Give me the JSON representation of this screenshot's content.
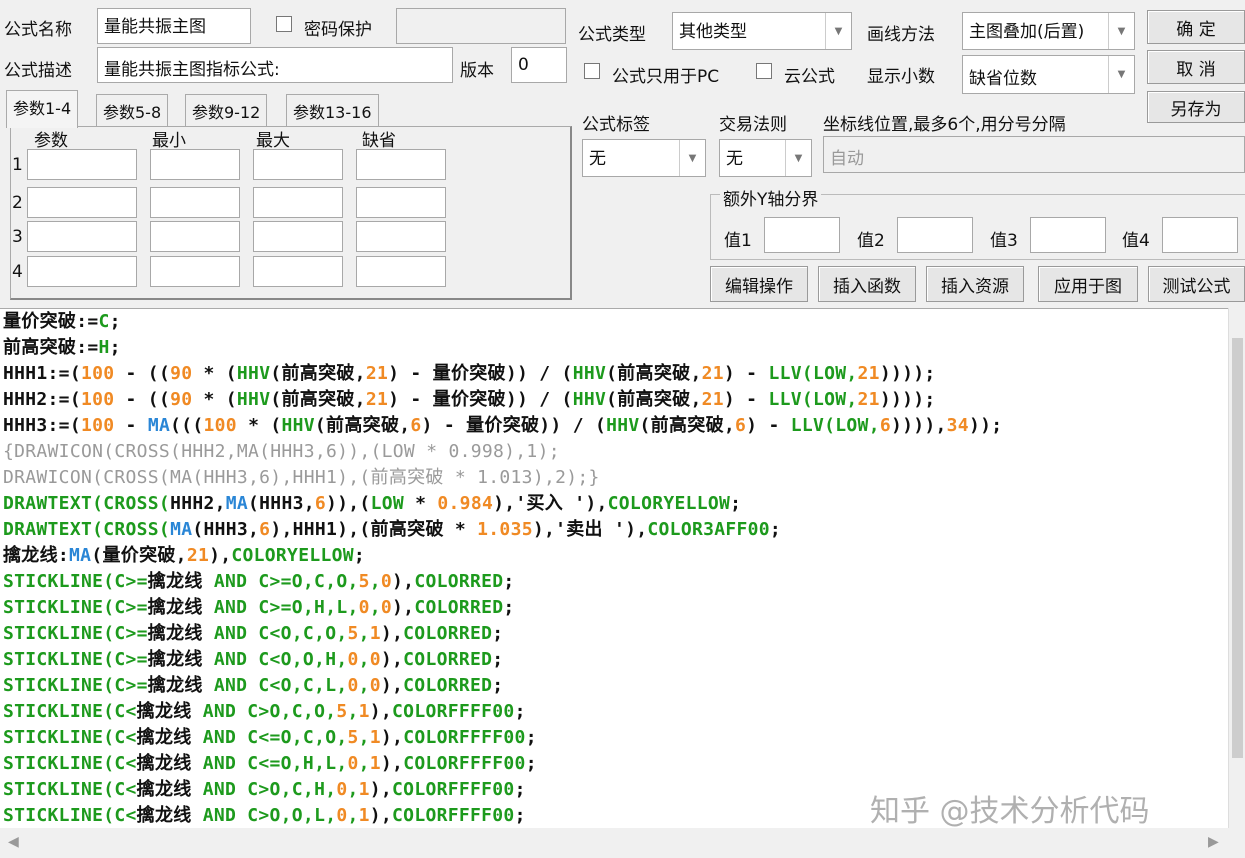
{
  "form": {
    "name_label": "公式名称",
    "name_value": "量能共振主图",
    "password_label": "密码保护",
    "desc_label": "公式描述",
    "desc_value": "量能共振主图指标公式:",
    "version_label": "版本",
    "version_value": "0",
    "type_label": "公式类型",
    "type_value": "其他类型",
    "draw_label": "画线方法",
    "draw_value": "主图叠加(后置)",
    "pc_only_label": "公式只用于PC",
    "cloud_label": "云公式",
    "decimal_label": "显示小数",
    "decimal_value": "缺省位数",
    "tag_label": "公式标签",
    "tag_value": "无",
    "rule_label": "交易法则",
    "rule_value": "无",
    "axis_label": "坐标线位置,最多6个,用分号分隔",
    "axis_placeholder": "自动",
    "yaxis_group": "额外Y轴分界",
    "values": [
      "值1",
      "值2",
      "值3",
      "值4"
    ]
  },
  "buttons": {
    "ok": "确  定",
    "cancel": "取  消",
    "save_as": "另存为",
    "edit": "编辑操作",
    "insert_func": "插入函数",
    "insert_res": "插入资源",
    "apply": "应用于图",
    "test": "测试公式"
  },
  "tabs": [
    "参数1-4",
    "参数5-8",
    "参数9-12",
    "参数13-16"
  ],
  "params": {
    "headers": [
      "参数",
      "最小",
      "最大",
      "缺省"
    ],
    "rows": [
      "1",
      "2",
      "3",
      "4"
    ]
  },
  "code_lines": [
    [
      [
        "k",
        "量价突破:="
      ],
      [
        "g",
        "C"
      ],
      [
        "k",
        ";"
      ]
    ],
    [
      [
        "k",
        "前高突破:="
      ],
      [
        "g",
        "H"
      ],
      [
        "k",
        ";"
      ]
    ],
    [
      [
        "k",
        "HHH1:=("
      ],
      [
        "o",
        "100"
      ],
      [
        "k",
        " - (("
      ],
      [
        "o",
        "90"
      ],
      [
        "k",
        " * ("
      ],
      [
        "g",
        "HHV"
      ],
      [
        "k",
        "(前高突破,"
      ],
      [
        "o",
        "21"
      ],
      [
        "k",
        ") - 量价突破)) / ("
      ],
      [
        "g",
        "HHV"
      ],
      [
        "k",
        "(前高突破,"
      ],
      [
        "o",
        "21"
      ],
      [
        "k",
        ") - "
      ],
      [
        "g",
        "LLV(LOW,"
      ],
      [
        "o",
        "21"
      ],
      [
        "k",
        "))));"
      ]
    ],
    [
      [
        "k",
        "HHH2:=("
      ],
      [
        "o",
        "100"
      ],
      [
        "k",
        " - (("
      ],
      [
        "o",
        "90"
      ],
      [
        "k",
        " * ("
      ],
      [
        "g",
        "HHV"
      ],
      [
        "k",
        "(前高突破,"
      ],
      [
        "o",
        "21"
      ],
      [
        "k",
        ") - 量价突破)) / ("
      ],
      [
        "g",
        "HHV"
      ],
      [
        "k",
        "(前高突破,"
      ],
      [
        "o",
        "21"
      ],
      [
        "k",
        ") - "
      ],
      [
        "g",
        "LLV(LOW,"
      ],
      [
        "o",
        "21"
      ],
      [
        "k",
        "))));"
      ]
    ],
    [
      [
        "k",
        "HHH3:=("
      ],
      [
        "o",
        "100"
      ],
      [
        "k",
        " - "
      ],
      [
        "b",
        "MA"
      ],
      [
        "k",
        "((("
      ],
      [
        "o",
        "100"
      ],
      [
        "k",
        " * ("
      ],
      [
        "g",
        "HHV"
      ],
      [
        "k",
        "(前高突破,"
      ],
      [
        "o",
        "6"
      ],
      [
        "k",
        ") - 量价突破)) / ("
      ],
      [
        "g",
        "HHV"
      ],
      [
        "k",
        "(前高突破,"
      ],
      [
        "o",
        "6"
      ],
      [
        "k",
        ") - "
      ],
      [
        "g",
        "LLV(LOW,"
      ],
      [
        "o",
        "6"
      ],
      [
        "k",
        ")))),"
      ],
      [
        "o",
        "34"
      ],
      [
        "k",
        "));"
      ]
    ],
    [
      [
        "c",
        "{DRAWICON(CROSS(HHH2,MA(HHH3,6)),(LOW * 0.998),1);"
      ]
    ],
    [
      [
        "c",
        "DRAWICON(CROSS(MA(HHH3,6),HHH1),(前高突破 * 1.013),2);}"
      ]
    ],
    [
      [
        "g",
        "DRAWTEXT(CROSS("
      ],
      [
        "k",
        "HHH2,"
      ],
      [
        "b",
        "MA"
      ],
      [
        "k",
        "(HHH3,"
      ],
      [
        "o",
        "6"
      ],
      [
        "k",
        ")),("
      ],
      [
        "g",
        "LOW"
      ],
      [
        "k",
        " * "
      ],
      [
        "o",
        "0.984"
      ],
      [
        "k",
        "),'买入 '),"
      ],
      [
        "g",
        "COLORYELLOW"
      ],
      [
        "k",
        ";"
      ]
    ],
    [
      [
        "g",
        "DRAWTEXT(CROSS("
      ],
      [
        "b",
        "MA"
      ],
      [
        "k",
        "(HHH3,"
      ],
      [
        "o",
        "6"
      ],
      [
        "k",
        "),HHH1),(前高突破 * "
      ],
      [
        "o",
        "1.035"
      ],
      [
        "k",
        "),'卖出 '),"
      ],
      [
        "g",
        "COLOR3AFF00"
      ],
      [
        "k",
        ";"
      ]
    ],
    [
      [
        "k",
        "擒龙线:"
      ],
      [
        "b",
        "MA"
      ],
      [
        "k",
        "(量价突破,"
      ],
      [
        "o",
        "21"
      ],
      [
        "k",
        "),"
      ],
      [
        "g",
        "COLORYELLOW"
      ],
      [
        "k",
        ";"
      ]
    ],
    [
      [
        "g",
        "STICKLINE(C>="
      ],
      [
        "k",
        "擒龙线"
      ],
      [
        "g",
        " AND C>=O,C,O,"
      ],
      [
        "o",
        "5"
      ],
      [
        "g",
        ","
      ],
      [
        "o",
        "0"
      ],
      [
        "k",
        "),"
      ],
      [
        "g",
        "COLORRED"
      ],
      [
        "k",
        ";"
      ]
    ],
    [
      [
        "g",
        "STICKLINE(C>="
      ],
      [
        "k",
        "擒龙线"
      ],
      [
        "g",
        " AND C>=O,H,L,"
      ],
      [
        "o",
        "0"
      ],
      [
        "g",
        ","
      ],
      [
        "o",
        "0"
      ],
      [
        "k",
        "),"
      ],
      [
        "g",
        "COLORRED"
      ],
      [
        "k",
        ";"
      ]
    ],
    [
      [
        "g",
        "STICKLINE(C>="
      ],
      [
        "k",
        "擒龙线"
      ],
      [
        "g",
        " AND C<O,C,O,"
      ],
      [
        "o",
        "5"
      ],
      [
        "g",
        ","
      ],
      [
        "o",
        "1"
      ],
      [
        "k",
        "),"
      ],
      [
        "g",
        "COLORRED"
      ],
      [
        "k",
        ";"
      ]
    ],
    [
      [
        "g",
        "STICKLINE(C>="
      ],
      [
        "k",
        "擒龙线"
      ],
      [
        "g",
        " AND C<O,O,H,"
      ],
      [
        "o",
        "0"
      ],
      [
        "g",
        ","
      ],
      [
        "o",
        "0"
      ],
      [
        "k",
        "),"
      ],
      [
        "g",
        "COLORRED"
      ],
      [
        "k",
        ";"
      ]
    ],
    [
      [
        "g",
        "STICKLINE(C>="
      ],
      [
        "k",
        "擒龙线"
      ],
      [
        "g",
        " AND C<O,C,L,"
      ],
      [
        "o",
        "0"
      ],
      [
        "g",
        ","
      ],
      [
        "o",
        "0"
      ],
      [
        "k",
        "),"
      ],
      [
        "g",
        "COLORRED"
      ],
      [
        "k",
        ";"
      ]
    ],
    [
      [
        "g",
        "STICKLINE(C<"
      ],
      [
        "k",
        "擒龙线"
      ],
      [
        "g",
        " AND C>O,C,O,"
      ],
      [
        "o",
        "5"
      ],
      [
        "g",
        ","
      ],
      [
        "o",
        "1"
      ],
      [
        "k",
        "),"
      ],
      [
        "g",
        "COLORFFFF00"
      ],
      [
        "k",
        ";"
      ]
    ],
    [
      [
        "g",
        "STICKLINE(C<"
      ],
      [
        "k",
        "擒龙线"
      ],
      [
        "g",
        " AND C<=O,C,O,"
      ],
      [
        "o",
        "5"
      ],
      [
        "g",
        ","
      ],
      [
        "o",
        "1"
      ],
      [
        "k",
        "),"
      ],
      [
        "g",
        "COLORFFFF00"
      ],
      [
        "k",
        ";"
      ]
    ],
    [
      [
        "g",
        "STICKLINE(C<"
      ],
      [
        "k",
        "擒龙线"
      ],
      [
        "g",
        " AND C<=O,H,L,"
      ],
      [
        "o",
        "0"
      ],
      [
        "g",
        ","
      ],
      [
        "o",
        "1"
      ],
      [
        "k",
        "),"
      ],
      [
        "g",
        "COLORFFFF00"
      ],
      [
        "k",
        ";"
      ]
    ],
    [
      [
        "g",
        "STICKLINE(C<"
      ],
      [
        "k",
        "擒龙线"
      ],
      [
        "g",
        " AND C>O,C,H,"
      ],
      [
        "o",
        "0"
      ],
      [
        "g",
        ","
      ],
      [
        "o",
        "1"
      ],
      [
        "k",
        "),"
      ],
      [
        "g",
        "COLORFFFF00"
      ],
      [
        "k",
        ";"
      ]
    ],
    [
      [
        "g",
        "STICKLINE(C<"
      ],
      [
        "k",
        "擒龙线"
      ],
      [
        "g",
        " AND C>O,O,L,"
      ],
      [
        "o",
        "0"
      ],
      [
        "g",
        ","
      ],
      [
        "o",
        "1"
      ],
      [
        "k",
        "),"
      ],
      [
        "g",
        "COLORFFFF00"
      ],
      [
        "k",
        ";"
      ]
    ]
  ],
  "watermark": "知乎 @技术分析代码",
  "colors": {
    "keyword": "#1d9a1d",
    "number": "#f08a24",
    "function": "#2a86d6",
    "comment": "#9a9a9a"
  }
}
